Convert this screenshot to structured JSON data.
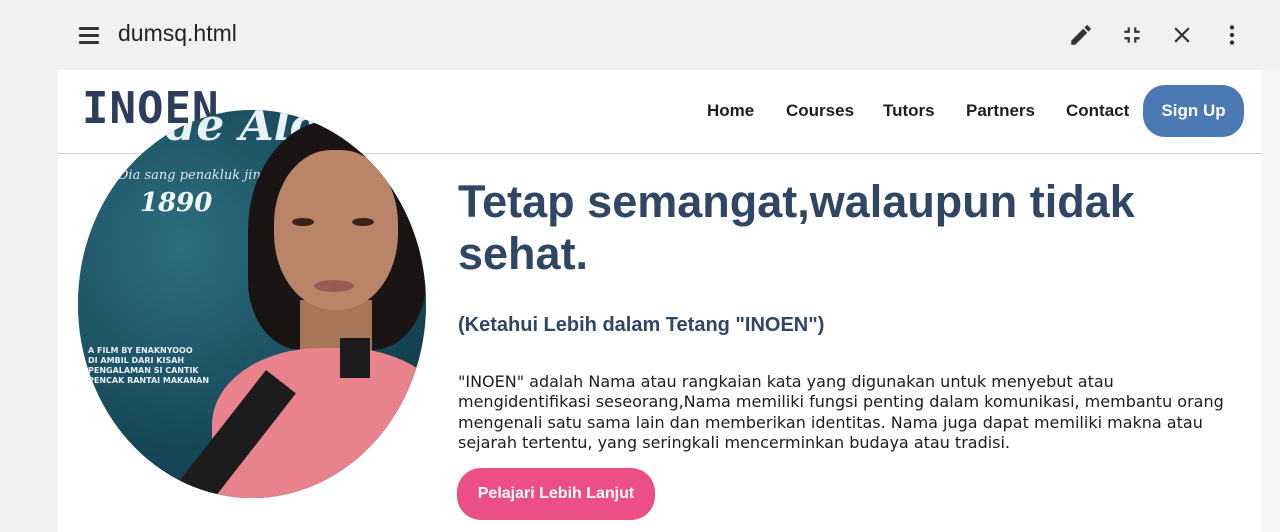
{
  "viewer": {
    "file_name": "dumsq.html",
    "icons": [
      "menu-icon",
      "pencil-icon",
      "collapse-icon",
      "close-icon",
      "more-vert-icon"
    ]
  },
  "site": {
    "logo": "INOEN",
    "nav": [
      {
        "label": "Home"
      },
      {
        "label": "Courses"
      },
      {
        "label": "Tutors"
      },
      {
        "label": "Partners"
      },
      {
        "label": "Contact"
      }
    ],
    "signup_label": "Sign Up"
  },
  "poster": {
    "title": "Gede Aldan",
    "subtitle": "Dia sang penakluk jin",
    "year": "1890",
    "credit": [
      "A FILM BY ENAKNYOOO",
      "DI AMBIL DARI KISAH",
      "PENGALAMAN SI CANTIK",
      "PENCAK RANTAI MAKANAN"
    ]
  },
  "hero": {
    "title": "Tetap semangat,walaupun tidak sehat.",
    "subtitle": "(Ketahui Lebih dalam Tetang \"INOEN\")",
    "body": "\"INOEN\" adalah Nama atau rangkaian kata yang digunakan untuk menyebut atau mengidentifikasi seseorang,Nama memiliki fungsi penting dalam komunikasi, membantu orang mengenali satu sama lain dan memberikan identitas. Nama juga dapat memiliki makna atau sejarah tertentu, yang seringkali mencerminkan budaya atau tradisi.",
    "cta_label": "Pelajari Lebih Lanjut"
  },
  "colors": {
    "brand": "#2f4664",
    "signup": "#4a79b3",
    "cta": "#ec4f86"
  }
}
